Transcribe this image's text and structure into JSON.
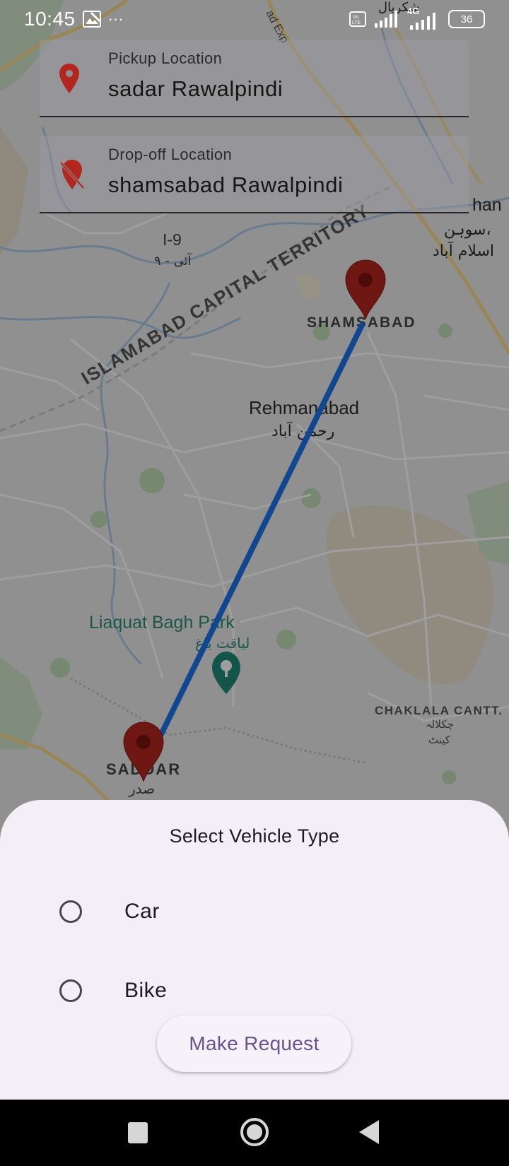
{
  "status_bar": {
    "time": "10:45",
    "overflow": "···",
    "network": "4G",
    "battery": "36",
    "icons": [
      "image-icon",
      "volte-icon",
      "signal-icon",
      "signal-4g-icon",
      "battery-icon"
    ]
  },
  "form": {
    "pickup": {
      "label": "Pickup Location",
      "value": "sadar Rawalpindi",
      "icon": "location-pin-icon"
    },
    "dropoff": {
      "label": "Drop-off Location",
      "value": "shamsabad Rawalpindi",
      "icon": "location-off-icon"
    }
  },
  "map": {
    "labels": {
      "i9": "I-9",
      "i9_urdu": "آئی - ۹",
      "territory": "ISLAMABAD CAPITAL TERRITORY",
      "shamsabad": "SHAMSABAD",
      "rehmanabad": "Rehmanabad",
      "rehmanabad_urdu": "رحمن آباد",
      "liaquat": "Liaquat Bagh Park",
      "liaquat_urdu": "لیاقت باغ",
      "chaklala": "CHAKLALA CANTT.",
      "chaklala_urdu1": "چکلالہ",
      "chaklala_urdu2": "کینٹ",
      "saddar": "SADDAR",
      "saddar_urdu": "صدر",
      "topright_en": "han",
      "topright_urdu1": "سوہن،",
      "topright_urdu2": "اسلام آباد",
      "top_urdu": "شکریال",
      "expressway": "ad Exp"
    },
    "colors": {
      "route": "#1a73e8",
      "marker": "#b3261e"
    }
  },
  "sheet": {
    "title": "Select Vehicle Type",
    "options": [
      {
        "label": "Car",
        "selected": false
      },
      {
        "label": "Bike",
        "selected": false
      }
    ],
    "button": "Make Request"
  },
  "nav": {
    "icons": [
      "recents-square-icon",
      "home-circle-icon",
      "back-triangle-icon"
    ]
  }
}
